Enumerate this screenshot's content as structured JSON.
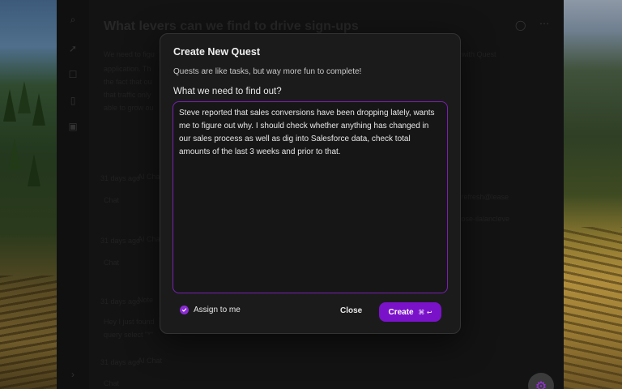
{
  "background": {
    "title": "What levers can we find to drive sign-ups",
    "body_lines": [
      "We need to figu",
      "application. Th",
      "the fact that ou",
      "that traffic only",
      "able to grow ou"
    ],
    "body_right": "with Quest",
    "feed": [
      {
        "meta": "31 days ago",
        "author": "AI Cha",
        "text": "Chat"
      },
      {
        "meta": "31 days ago",
        "author": "AI Cha",
        "text": "Chat"
      },
      {
        "meta": "31 days ago",
        "author": "Note",
        "text": "Hey I just found",
        "text2": "query select \"*\""
      },
      {
        "meta": "31 days ago",
        "author": "AI Chat",
        "text": "Chat"
      }
    ],
    "side_snippets": [
      "...refresh@lease",
      "...ose-ilalancleve"
    ]
  },
  "modal": {
    "title": "Create New Quest",
    "subtitle": "Quests are like tasks, but way more fun to complete!",
    "field_label": "What we need to find out?",
    "field_value": "Steve reported that sales conversions have been dropping lately, wants me to figure out why. I should check whether anything has changed in our sales process as well as dig into Salesforce data, check total amounts of the last 3 weeks and prior to that.",
    "assign_label": "Assign to me",
    "assign_checked": true,
    "close_label": "Close",
    "create_label": "Create",
    "create_shortcut": "⌘ ↩"
  },
  "colors": {
    "accent": "#7a12c9",
    "border_focus": "#7a1fb3"
  },
  "icons": [
    "search-icon",
    "rocket-icon",
    "chat-icon",
    "trash-icon",
    "calendar-icon",
    "globe-icon",
    "more-icon",
    "gear-icon",
    "check-icon"
  ]
}
